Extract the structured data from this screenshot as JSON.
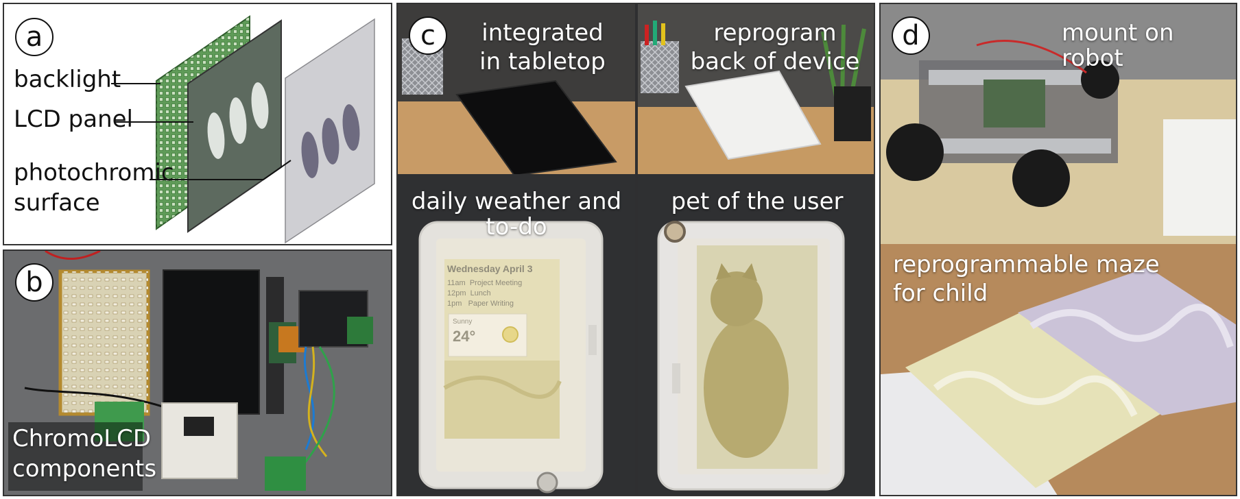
{
  "panel_a": {
    "letter": "a",
    "labels": {
      "backlight": "backlight",
      "lcd": "LCD panel",
      "photochromic_line1": "photochromic",
      "photochromic_line2": "surface"
    }
  },
  "panel_b": {
    "letter": "b",
    "caption_line1": "ChromoLCD",
    "caption_line2": "components"
  },
  "panel_c": {
    "letter": "c",
    "tl_line1": "integrated",
    "tl_line2": "in tabletop",
    "tr_line1": "reprogram",
    "tr_line2": "back of device",
    "bl_caption": "daily weather and to-do",
    "br_caption": "pet of the user",
    "weather": {
      "date": "Wednesday  April 3",
      "items": [
        {
          "time": "11am",
          "task": "Project Meeting"
        },
        {
          "time": "12pm",
          "task": "Lunch"
        },
        {
          "time": "1pm",
          "task": "Paper Writing"
        }
      ],
      "condition": "Sunny",
      "temperature": "24°"
    }
  },
  "panel_d": {
    "letter": "d",
    "top_caption": "mount on robot",
    "bottom_line1": "reprogrammable maze",
    "bottom_line2": "for child"
  }
}
